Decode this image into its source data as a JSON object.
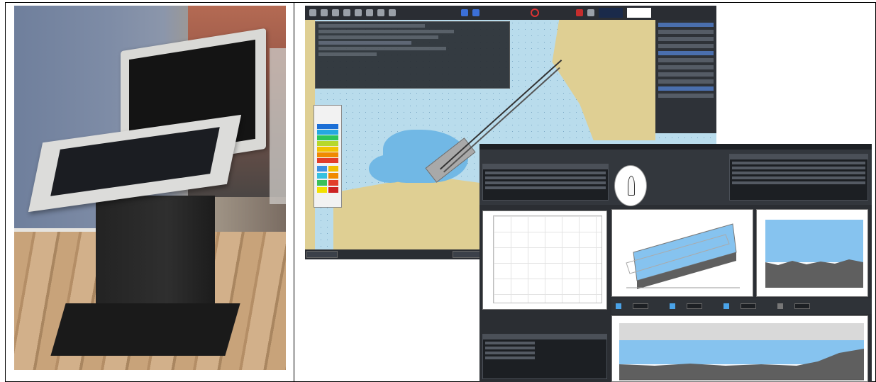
{
  "figure": {
    "left_panel": "photo-ecdis-console",
    "right_panel": "ecdis-software-screens"
  },
  "colors": {
    "sea": "#b9dcec",
    "land": "#dfcf93",
    "shallow_water": "#71b8e5",
    "panel_dark": "#2b2e33",
    "plot_fill_blue": "#86c3ef",
    "plot_fill_gray": "#5f5f5f"
  },
  "icons": {
    "toolbar": [
      "menu-icon",
      "chart-icon",
      "globe-icon",
      "settings-icon",
      "layers-icon",
      "route-icon",
      "ship-icon",
      "alarm-icon"
    ]
  }
}
